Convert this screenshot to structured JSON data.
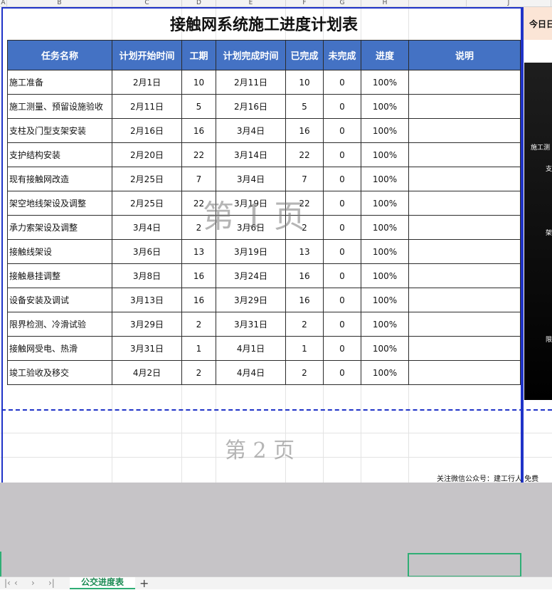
{
  "column_headers": [
    "A",
    "B",
    "C",
    "D",
    "E",
    "F",
    "G",
    "H",
    "",
    "J"
  ],
  "title": "接触网系统施工进度计划表",
  "table": {
    "headers": [
      "任务名称",
      "计划开始时间",
      "工期",
      "计划完成时间",
      "已完成",
      "未完成",
      "进度",
      "说明"
    ],
    "rows": [
      [
        "施工准备",
        "2月1日",
        "10",
        "2月11日",
        "10",
        "0",
        "100%",
        ""
      ],
      [
        "施工测量、预留设施验收",
        "2月11日",
        "5",
        "2月16日",
        "5",
        "0",
        "100%",
        ""
      ],
      [
        "支柱及门型支架安装",
        "2月16日",
        "16",
        "3月4日",
        "16",
        "0",
        "100%",
        ""
      ],
      [
        "支护结构安装",
        "2月20日",
        "22",
        "3月14日",
        "22",
        "0",
        "100%",
        ""
      ],
      [
        "现有接触网改造",
        "2月25日",
        "7",
        "3月4日",
        "7",
        "0",
        "100%",
        ""
      ],
      [
        "架空地线架设及调整",
        "2月25日",
        "22",
        "3月19日",
        "22",
        "0",
        "100%",
        ""
      ],
      [
        "承力索架设及调整",
        "3月4日",
        "2",
        "3月6日",
        "2",
        "0",
        "100%",
        ""
      ],
      [
        "接触线架设",
        "3月6日",
        "13",
        "3月19日",
        "13",
        "0",
        "100%",
        ""
      ],
      [
        "接触悬挂调整",
        "3月8日",
        "16",
        "3月24日",
        "16",
        "0",
        "100%",
        ""
      ],
      [
        "设备安装及调试",
        "3月13日",
        "16",
        "3月29日",
        "16",
        "0",
        "100%",
        ""
      ],
      [
        "限界检测、冷滑试验",
        "3月29日",
        "2",
        "3月31日",
        "2",
        "0",
        "100%",
        ""
      ],
      [
        "接触网受电、热滑",
        "3月31日",
        "1",
        "4月1日",
        "1",
        "0",
        "100%",
        ""
      ],
      [
        "竣工验收及移交",
        "4月2日",
        "2",
        "4月4日",
        "2",
        "0",
        "100%",
        ""
      ]
    ]
  },
  "watermarks": {
    "page1": "第 1 页",
    "page2": "第 2 页"
  },
  "right_label": "今日日",
  "right_panel_texts": [
    "施工测",
    "支",
    "架",
    "限"
  ],
  "footer_note": "关注微信公众号：建工行人 免费",
  "sheet_tab": "公交进度表",
  "nav_icons": [
    "first-sheet-icon",
    "prev-sheet-icon",
    "next-sheet-icon",
    "last-sheet-icon"
  ],
  "colors": {
    "header_bg": "#4472c4",
    "page_border": "#1f33c8",
    "accent": "#2fae75"
  }
}
